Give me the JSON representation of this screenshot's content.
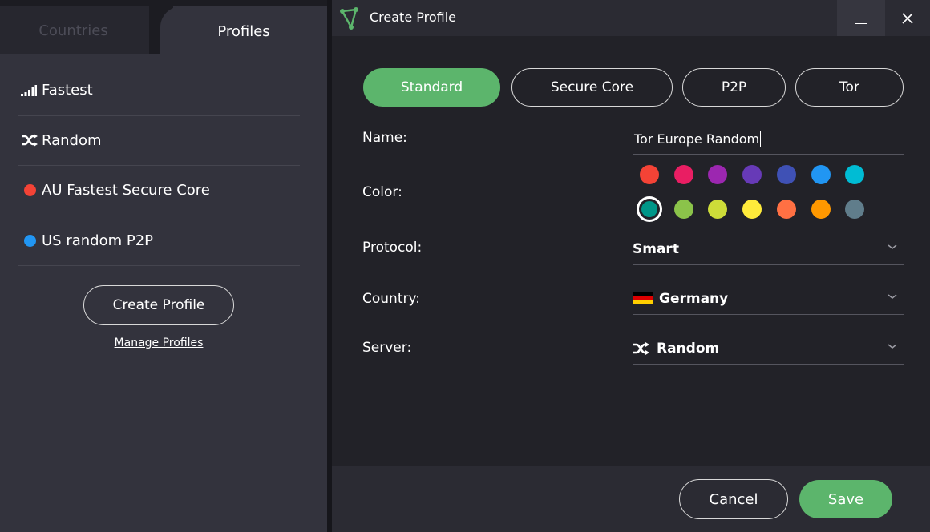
{
  "sidebar": {
    "tabs": [
      {
        "label": "Countries",
        "active": false
      },
      {
        "label": "Profiles",
        "active": true
      }
    ],
    "profiles": [
      {
        "label": "Fastest",
        "icon": "signal-bars-icon"
      },
      {
        "label": "Random",
        "icon": "shuffle-icon"
      },
      {
        "label": "AU Fastest Secure Core",
        "icon": "color-dot",
        "color": "#F44336"
      },
      {
        "label": "US random P2P",
        "icon": "color-dot",
        "color": "#2196F3"
      }
    ],
    "create_profile_label": "Create Profile",
    "manage_profiles_label": "Manage Profiles"
  },
  "dialog": {
    "title": "Create Profile",
    "window_controls": {
      "minimize": "minimize",
      "close": "close"
    },
    "type_tabs": [
      {
        "label": "Standard",
        "active": true
      },
      {
        "label": "Secure Core",
        "active": false
      },
      {
        "label": "P2P",
        "active": false
      },
      {
        "label": "Tor",
        "active": false
      }
    ],
    "fields": {
      "name_label": "Name:",
      "name_value": "Tor Europe Random",
      "color_label": "Color:",
      "protocol_label": "Protocol:",
      "protocol_value": "Smart",
      "country_label": "Country:",
      "country_value": "Germany",
      "server_label": "Server:",
      "server_value": "Random"
    },
    "colors": [
      [
        "#F44336",
        "#E91E63",
        "#9C27B0",
        "#673AB7",
        "#3F51B5",
        "#2196F3",
        "#00BCD4"
      ],
      [
        "#009688",
        "#8BC34A",
        "#CDDC39",
        "#FFEB3B",
        "#FF7043",
        "#FF9800",
        "#607D8B"
      ]
    ],
    "selected_color": "#009688",
    "cancel_label": "Cancel",
    "save_label": "Save",
    "accent_color": "#5CB56C"
  }
}
